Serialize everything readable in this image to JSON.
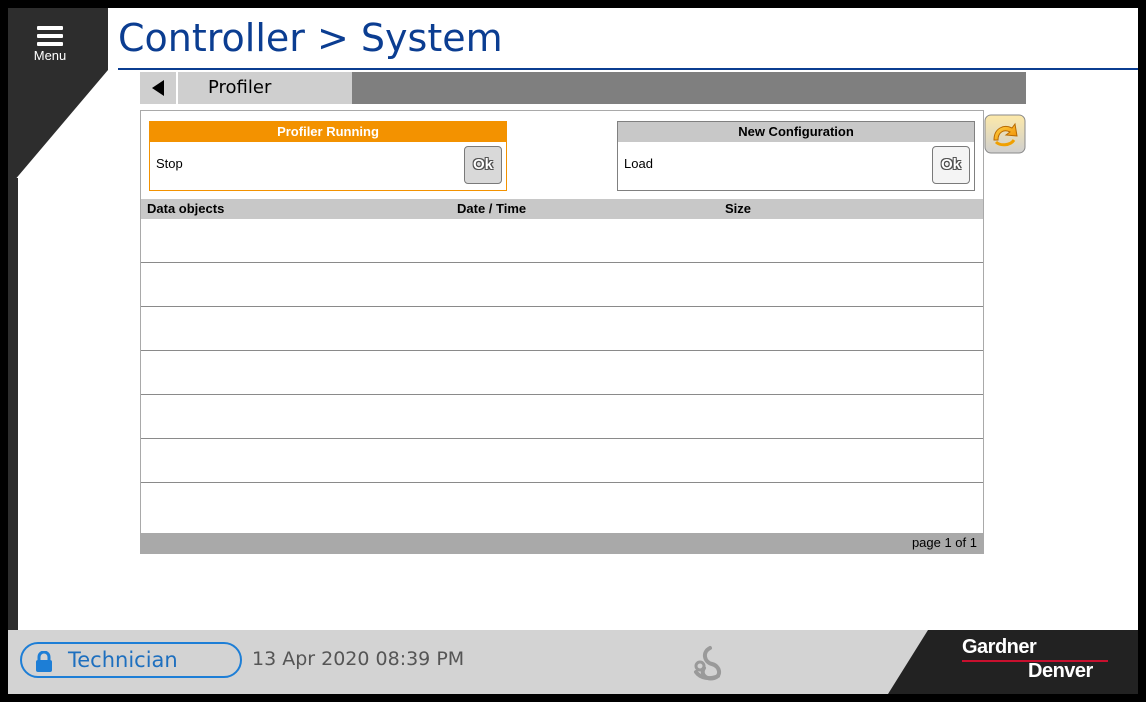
{
  "menu": {
    "label": "Menu"
  },
  "header": {
    "title": "Controller > System"
  },
  "tabs": {
    "active_label": "Profiler"
  },
  "profiler_box": {
    "header": "Profiler Running",
    "action_label": "Stop",
    "ok_label": "Ok"
  },
  "config_box": {
    "header": "New Configuration",
    "action_label": "Load",
    "ok_label": "Ok"
  },
  "table": {
    "columns": [
      "Data objects",
      "Date / Time",
      "Size"
    ],
    "rows": [],
    "pagination": "page 1 of 1"
  },
  "footer": {
    "user_role": "Technician",
    "datetime": "13 Apr 2020  08:39 PM",
    "brand_line1": "Gardner",
    "brand_line2": "Denver"
  },
  "colors": {
    "title_blue": "#0b3d91",
    "accent_orange": "#f39200",
    "user_blue": "#1d7ed6"
  }
}
